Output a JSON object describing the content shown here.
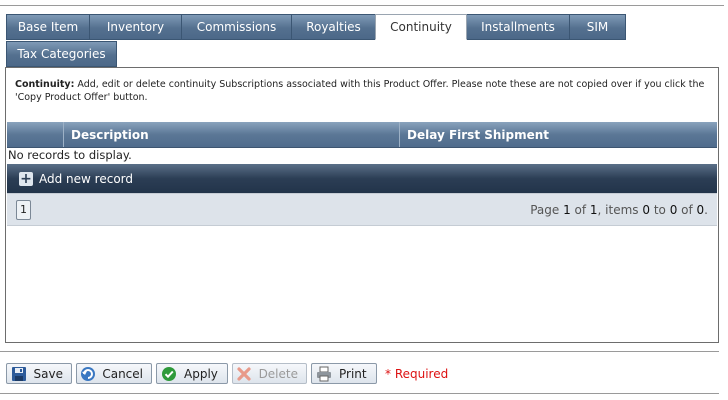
{
  "tabs": {
    "row1": [
      {
        "label": "Base Item",
        "width": 83
      },
      {
        "label": "Inventory",
        "width": 92
      },
      {
        "label": "Commissions",
        "width": 110
      },
      {
        "label": "Royalties",
        "width": 84
      },
      {
        "label": "Continuity",
        "width": 92,
        "active": true
      },
      {
        "label": "Installments",
        "width": 102
      },
      {
        "label": "SIM",
        "width": 57
      }
    ],
    "row2": [
      {
        "label": "Tax Categories",
        "width": 111
      }
    ]
  },
  "note": {
    "bold": "Continuity:",
    "text": " Add, edit or delete continuity Subscriptions associated with this Product Offer. Please note these are not copied over if you click the 'Copy Product Offer' button."
  },
  "grid": {
    "columns": [
      "",
      "Description",
      "Delay First Shipment"
    ],
    "empty_message": "No records to display.",
    "add_label": "Add new record",
    "pager": {
      "current_page": "1",
      "info_prefix": "Page ",
      "page": "1",
      "of_label": " of ",
      "pages": "1",
      "items_label": ", items ",
      "from": "0",
      "to_label": " to ",
      "to": "0",
      "total_label": " of ",
      "total": "0",
      "end": "."
    }
  },
  "toolbar": {
    "save": "Save",
    "cancel": "Cancel",
    "apply": "Apply",
    "delete": "Delete",
    "print": "Print",
    "required": "* Required"
  }
}
